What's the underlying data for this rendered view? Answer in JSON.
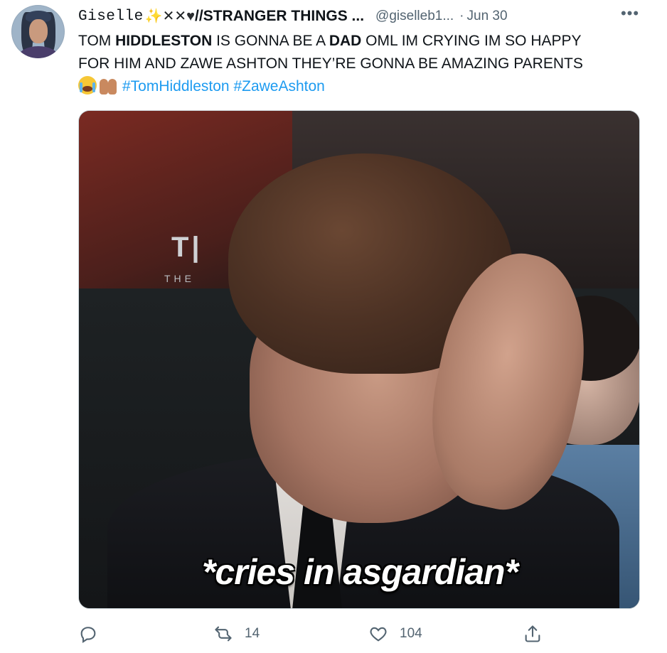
{
  "tweet": {
    "display_name": "Giselle",
    "display_name_tail": "//STRANGER THINGS ...",
    "name_emojis": [
      "sparkles-icon",
      "cross-mark-icon",
      "cross-mark-icon",
      "black-heart-icon"
    ],
    "handle": "@giselleb1...",
    "separator": "·",
    "date": "Jun 30",
    "more_label": "•••",
    "text": {
      "line1": {
        "p1": "TOM ",
        "b1": "HIDDLESTON",
        "p2": " IS GONNA BE A ",
        "b2": "DAD",
        "p3": " OML IM CRYING IM SO HAPPY"
      },
      "line2": "FOR HIM AND ZAWE ASHTON THEY’RE GONNA BE AMAZING PARENTS",
      "line3_emojis": [
        "loudly-crying-face-icon",
        "raising-hands-icon"
      ],
      "hashtags": [
        "#TomHiddleston",
        "#ZaweAshton"
      ]
    },
    "media": {
      "caption": "*cries in asgardian*"
    },
    "actions": {
      "reply_count": "",
      "retweet_count": "14",
      "like_count": "104"
    },
    "colors": {
      "link": "#1d9bf0",
      "secondary_text": "#536471",
      "primary_text": "#0f1419"
    }
  }
}
